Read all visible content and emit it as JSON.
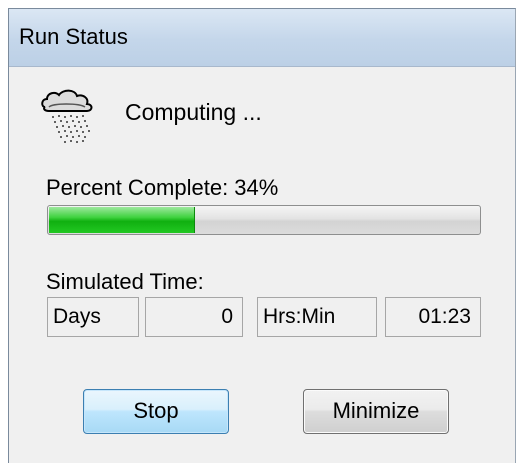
{
  "window": {
    "title": "Run Status"
  },
  "status": {
    "icon": "rain-cloud-icon",
    "text": "Computing ..."
  },
  "progress": {
    "label": "Percent Complete: 34%",
    "value": 34
  },
  "simulated_time": {
    "label": "Simulated Time:",
    "days_label": "Days",
    "days_value": "0",
    "hrsmin_label": "Hrs:Min",
    "hrsmin_value": "01:23"
  },
  "buttons": {
    "stop_label": "Stop",
    "minimize_label": "Minimize"
  },
  "colors": {
    "progress_fill": "#22c822",
    "stop_button_border": "#3c7fb1",
    "titlebar": "#c4d6ea"
  }
}
